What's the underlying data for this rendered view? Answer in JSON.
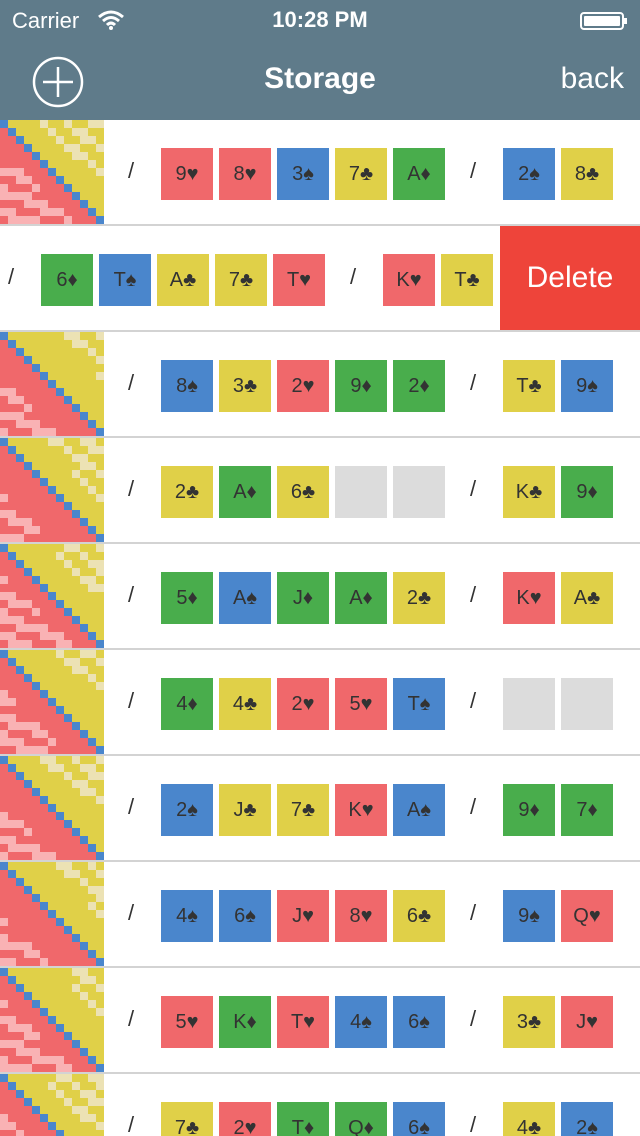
{
  "status_bar": {
    "carrier": "Carrier",
    "time": "10:28 PM"
  },
  "header": {
    "title": "Storage",
    "back_label": "back",
    "add_icon": "plus-circle-icon"
  },
  "delete_label": "Delete",
  "colors": {
    "header": "#5f7b8a",
    "heart": "#f0686b",
    "spade": "#4a86cc",
    "club": "#e0d048",
    "diamond": "#49ad4c",
    "empty": "#dcdcdc",
    "delete": "#ee443a"
  },
  "rows": [
    {
      "board": [
        "9♥",
        "8♥",
        "3♠",
        "7♣",
        "A♦"
      ],
      "hand": [
        "2♠",
        "8♣"
      ]
    },
    {
      "board": [
        "6♦",
        "T♠",
        "A♣",
        "7♣",
        "T♥"
      ],
      "hand": [
        "K♥",
        "T♣"
      ],
      "swiped": true
    },
    {
      "board": [
        "8♠",
        "3♣",
        "2♥",
        "9♦",
        "2♦"
      ],
      "hand": [
        "T♣",
        "9♠"
      ]
    },
    {
      "board": [
        "2♣",
        "A♦",
        "6♣",
        "",
        ""
      ],
      "hand": [
        "K♣",
        "9♦"
      ]
    },
    {
      "board": [
        "5♦",
        "A♠",
        "J♦",
        "A♦",
        "2♣"
      ],
      "hand": [
        "K♥",
        "A♣"
      ]
    },
    {
      "board": [
        "4♦",
        "4♣",
        "2♥",
        "5♥",
        "T♠"
      ],
      "hand": [
        "",
        ""
      ]
    },
    {
      "board": [
        "2♠",
        "J♣",
        "7♣",
        "K♥",
        "A♠"
      ],
      "hand": [
        "9♦",
        "7♦"
      ]
    },
    {
      "board": [
        "4♠",
        "6♠",
        "J♥",
        "8♥",
        "6♣"
      ],
      "hand": [
        "9♠",
        "Q♥"
      ]
    },
    {
      "board": [
        "5♥",
        "K♦",
        "T♥",
        "4♠",
        "6♠"
      ],
      "hand": [
        "3♣",
        "J♥"
      ]
    },
    {
      "board": [
        "7♣",
        "2♥",
        "T♦",
        "Q♦",
        "6♠"
      ],
      "hand": [
        "4♣",
        "2♠"
      ]
    }
  ]
}
